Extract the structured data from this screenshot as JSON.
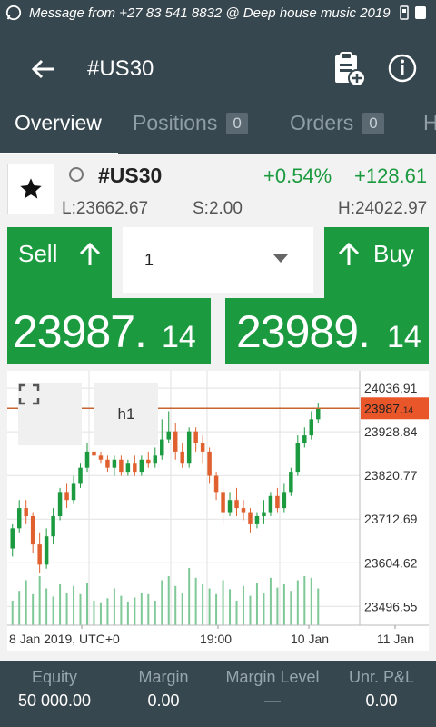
{
  "status_bar": {
    "message": "Message from +27 83 541 8832 @ Deep house music 2019"
  },
  "app_bar": {
    "title": "#US30"
  },
  "tabs": [
    {
      "label": "Overview",
      "count": null,
      "active": true
    },
    {
      "label": "Positions",
      "count": "0",
      "active": false
    },
    {
      "label": "Orders",
      "count": "0",
      "active": false
    },
    {
      "label": "H",
      "count": null,
      "active": false
    }
  ],
  "instrument": {
    "symbol": "#US30",
    "change_pct": "+0.54%",
    "change_abs": "+128.61",
    "low": "L:23662.67",
    "spread": "S:2.00",
    "high": "H:24022.97"
  },
  "trade": {
    "sell_label": "Sell",
    "buy_label": "Buy",
    "quantity": "1",
    "sell_price_main": "23987.",
    "sell_price_small": "14",
    "buy_price_main": "23989.",
    "buy_price_small": "14"
  },
  "chart_data": {
    "type": "candlestick",
    "timeframe": "h1",
    "current_price_main": "23987.",
    "current_price_small": "14",
    "y_ticks": [
      "24036.91",
      "23928.84",
      "23820.77",
      "23712.69",
      "23604.62",
      "23496.55"
    ],
    "y_tick_values": [
      24036.91,
      23928.84,
      23820.77,
      23712.69,
      23604.62,
      23496.55
    ],
    "x_ticks": [
      "8 Jan 2019, UTC+0",
      "19:00",
      "10 Jan",
      "11 Jan"
    ],
    "ylim": [
      23450,
      24080
    ],
    "current_price": 23987.14,
    "colors": {
      "up": "#1b9a3f",
      "down": "#e0612f",
      "price_line": "#c8642f",
      "volume": "#7fc897"
    },
    "candles": [
      [
        23640,
        23690,
        23620,
        23700
      ],
      [
        23690,
        23740,
        23680,
        23760
      ],
      [
        23740,
        23720,
        23700,
        23760
      ],
      [
        23720,
        23650,
        23630,
        23730
      ],
      [
        23650,
        23600,
        23580,
        23680
      ],
      [
        23600,
        23670,
        23590,
        23690
      ],
      [
        23670,
        23720,
        23650,
        23740
      ],
      [
        23720,
        23780,
        23710,
        23790
      ],
      [
        23780,
        23760,
        23740,
        23800
      ],
      [
        23760,
        23800,
        23750,
        23820
      ],
      [
        23800,
        23840,
        23790,
        23850
      ],
      [
        23840,
        23880,
        23830,
        23900
      ],
      [
        23880,
        23870,
        23860,
        23890
      ],
      [
        23870,
        23860,
        23850,
        23880
      ],
      [
        23860,
        23840,
        23830,
        23870
      ],
      [
        23840,
        23860,
        23820,
        23870
      ],
      [
        23860,
        23830,
        23820,
        23870
      ],
      [
        23830,
        23850,
        23820,
        23860
      ],
      [
        23850,
        23830,
        23820,
        23870
      ],
      [
        23830,
        23860,
        23820,
        23870
      ],
      [
        23860,
        23850,
        23840,
        23880
      ],
      [
        23850,
        23870,
        23840,
        23890
      ],
      [
        23870,
        23910,
        23860,
        23960
      ],
      [
        23910,
        23930,
        23900,
        23980
      ],
      [
        23930,
        23880,
        23860,
        23950
      ],
      [
        23880,
        23850,
        23840,
        23900
      ],
      [
        23850,
        23930,
        23840,
        23940
      ],
      [
        23930,
        23900,
        23880,
        23940
      ],
      [
        23900,
        23880,
        23850,
        23920
      ],
      [
        23880,
        23820,
        23800,
        23890
      ],
      [
        23820,
        23780,
        23760,
        23830
      ],
      [
        23780,
        23730,
        23700,
        23790
      ],
      [
        23730,
        23760,
        23720,
        23780
      ],
      [
        23760,
        23740,
        23720,
        23790
      ],
      [
        23740,
        23730,
        23710,
        23760
      ],
      [
        23730,
        23700,
        23680,
        23740
      ],
      [
        23700,
        23720,
        23690,
        23730
      ],
      [
        23720,
        23730,
        23700,
        23760
      ],
      [
        23730,
        23770,
        23720,
        23780
      ],
      [
        23770,
        23740,
        23730,
        23790
      ],
      [
        23740,
        23780,
        23730,
        23800
      ],
      [
        23780,
        23830,
        23770,
        23840
      ],
      [
        23830,
        23900,
        23820,
        23920
      ],
      [
        23900,
        23920,
        23890,
        23940
      ],
      [
        23920,
        23960,
        23910,
        23980
      ],
      [
        23960,
        23987,
        23950,
        24000
      ]
    ],
    "volumes": [
      30,
      42,
      55,
      38,
      60,
      45,
      35,
      50,
      40,
      48,
      38,
      52,
      30,
      28,
      33,
      45,
      36,
      29,
      34,
      40,
      38,
      30,
      55,
      60,
      48,
      40,
      70,
      58,
      50,
      45,
      38,
      55,
      44,
      30,
      48,
      36,
      52,
      40,
      58,
      46,
      50,
      42,
      55,
      60,
      58,
      45
    ]
  },
  "footer": [
    {
      "label": "Equity",
      "value": "50 000.00"
    },
    {
      "label": "Margin",
      "value": "0.00"
    },
    {
      "label": "Margin Level",
      "value": "—"
    },
    {
      "label": "Unr. P&L",
      "value": "0.00"
    }
  ]
}
